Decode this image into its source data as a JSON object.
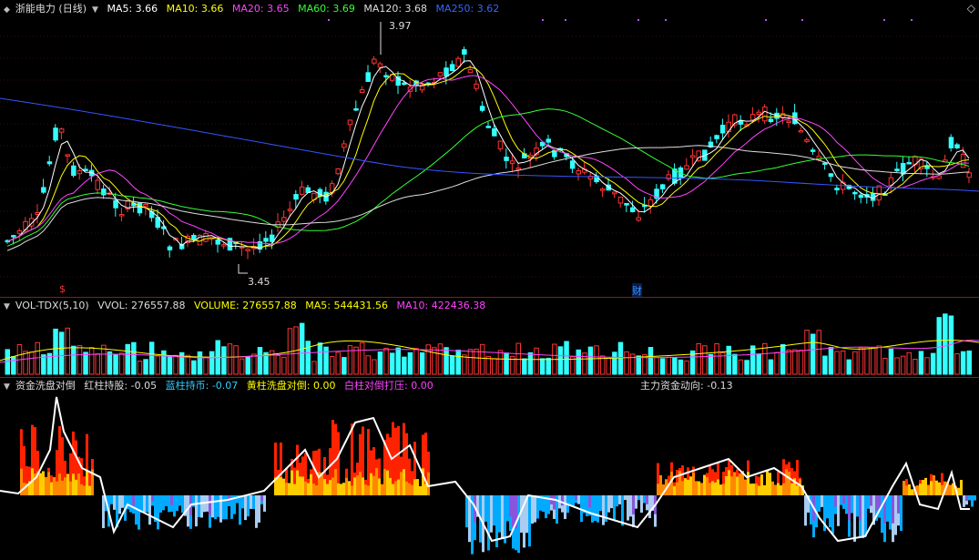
{
  "price_pane": {
    "title": "浙能电力 (日线)",
    "indicators": [
      {
        "label": "MA5:",
        "value": "3.66",
        "color": "#ffffff"
      },
      {
        "label": "MA10:",
        "value": "3.66",
        "color": "#ffff00"
      },
      {
        "label": "MA20:",
        "value": "3.65",
        "color": "#ff44ff"
      },
      {
        "label": "MA60:",
        "value": "3.69",
        "color": "#33ff33"
      },
      {
        "label": "MA120:",
        "value": "3.68",
        "color": "#dddddd"
      },
      {
        "label": "MA250:",
        "value": "3.62",
        "color": "#3366ff"
      }
    ],
    "high_label": "3.97",
    "low_label": "3.45",
    "event_markers": [
      "$",
      "财"
    ],
    "corner_icon": "diamond-icon"
  },
  "volume_pane": {
    "name": "VOL-TDX(5,10)",
    "items": [
      {
        "label": "VVOL:",
        "value": "276557.88",
        "color": "#dddddd"
      },
      {
        "label": "VOLUME:",
        "value": "276557.88",
        "color": "#ffff00"
      },
      {
        "label": "MA5:",
        "value": "544431.56",
        "color": "#ffff00"
      },
      {
        "label": "MA10:",
        "value": "422436.38",
        "color": "#ff44ff"
      }
    ]
  },
  "flow_pane": {
    "name": "资金洗盘对倒",
    "items": [
      {
        "label": "红柱持股:",
        "value": "-0.05",
        "color": "#dddddd"
      },
      {
        "label": "蓝柱持币:",
        "value": "-0.07",
        "color": "#33ccff"
      },
      {
        "label": "黄柱洗盘对倒:",
        "value": "0.00",
        "color": "#ffff00"
      },
      {
        "label": "白柱对倒打压:",
        "value": "0.00",
        "color": "#ff44ff"
      }
    ],
    "direction_label": "主力资金动向:",
    "direction_value": "-0.13"
  },
  "colors": {
    "up": "#ff3333",
    "down": "#33ffff",
    "separator": "#8b1a1a"
  }
}
